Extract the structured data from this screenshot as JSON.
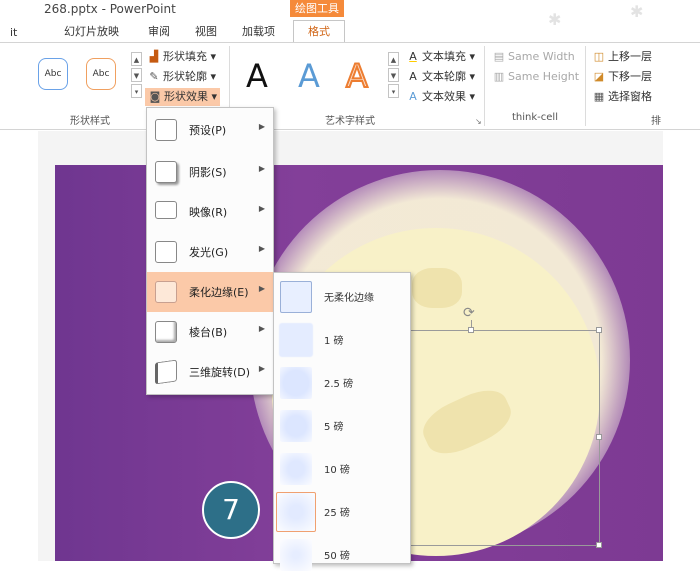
{
  "window": {
    "title": "268.pptx - PowerPoint",
    "context_tab": "绘图工具"
  },
  "menu_tabs": [
    "幻灯片放映",
    "审阅",
    "视图",
    "加载项",
    "格式"
  ],
  "ribbon": {
    "shape_styles": {
      "group_label": "形状样式",
      "swatch_1": "Abc",
      "swatch_2": "Abc",
      "fill": "形状填充",
      "outline": "形状轮廓",
      "effects": "形状效果"
    },
    "art_styles": {
      "group_label": "艺术字样式",
      "letter_1": "A",
      "letter_2": "A",
      "letter_3": "A",
      "text_fill": "文本填充",
      "text_outline": "文本轮廓",
      "text_effects": "文本效果"
    },
    "think_cell": {
      "group_label": "think-cell",
      "same_width": "Same Width",
      "same_height": "Same Height"
    },
    "arrange": {
      "group_label": "排",
      "bring_forward": "上移一层",
      "send_backward": "下移一层",
      "selection_pane": "选择窗格"
    }
  },
  "effects_menu": [
    {
      "label": "预设(P)",
      "icon": "preset-box-icon"
    },
    {
      "label": "阴影(S)",
      "icon": "shadow-box-icon"
    },
    {
      "label": "映像(R)",
      "icon": "reflection-box-icon"
    },
    {
      "label": "发光(G)",
      "icon": "glow-box-icon"
    },
    {
      "label": "柔化边缘(E)",
      "icon": "soft-edge-box-icon",
      "active": true
    },
    {
      "label": "棱台(B)",
      "icon": "bevel-box-icon"
    },
    {
      "label": "三维旋转(D)",
      "icon": "3d-rotation-box-icon"
    }
  ],
  "soft_edges_menu": [
    {
      "label": "无柔化边缘"
    },
    {
      "label": "1 磅"
    },
    {
      "label": "2.5 磅"
    },
    {
      "label": "5 磅"
    },
    {
      "label": "10 磅"
    },
    {
      "label": "25 磅",
      "selected": true
    },
    {
      "label": "50 磅"
    }
  ],
  "step_badge": "7",
  "colors": {
    "accent_orange": "#f58a3a",
    "menu_highlight": "#fbc9a8",
    "slide_purple": "#7d3a93",
    "moon": "#f8f1c8",
    "badge": "#2d6f88"
  }
}
